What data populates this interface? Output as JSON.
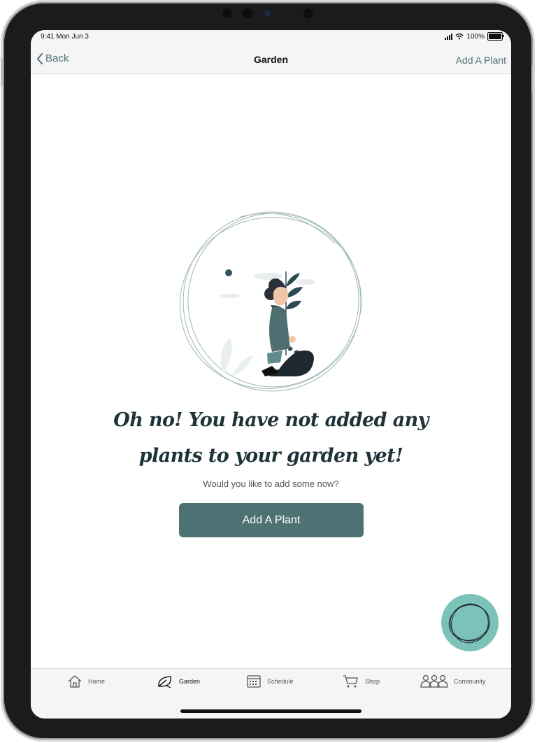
{
  "status_bar": {
    "time": "9:41",
    "date": "Mon Jun 3",
    "battery": "100%",
    "battery_level": 1.0
  },
  "nav": {
    "back_label": "Back",
    "title": "Garden",
    "action_label": "Add A Plant"
  },
  "empty_state": {
    "headline_line1": "Oh no! You have not added any",
    "headline_line2": "plants to your garden yet!",
    "subtext": "Would you like to add some now?",
    "button_label": "Add A Plant"
  },
  "tabs": [
    {
      "label": "Home",
      "icon": "home-icon",
      "active": false
    },
    {
      "label": "Garden",
      "icon": "leaf-icon",
      "active": true
    },
    {
      "label": "Schedule",
      "icon": "calendar-icon",
      "active": false
    },
    {
      "label": "Shop",
      "icon": "cart-icon",
      "active": false
    },
    {
      "label": "Community",
      "icon": "people-icon",
      "active": false
    }
  ],
  "colors": {
    "accent": "#4d7275",
    "button": "#4e7274",
    "fab": "#7bc3b9",
    "headline": "#1e3338"
  }
}
